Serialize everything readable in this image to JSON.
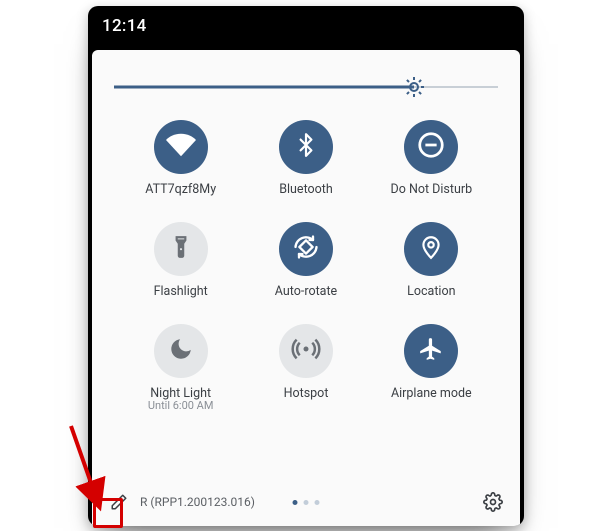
{
  "statusbar": {
    "time": "12:14"
  },
  "brightness": {
    "value": 0.78
  },
  "tiles": [
    {
      "id": "wifi",
      "label": "ATT7qzf8My",
      "sublabel": "",
      "active": true,
      "icon": "wifi"
    },
    {
      "id": "bluetooth",
      "label": "Bluetooth",
      "sublabel": "",
      "active": true,
      "icon": "bluetooth"
    },
    {
      "id": "dnd",
      "label": "Do Not Disturb",
      "sublabel": "",
      "active": true,
      "icon": "dnd"
    },
    {
      "id": "flashlight",
      "label": "Flashlight",
      "sublabel": "",
      "active": false,
      "icon": "flashlight"
    },
    {
      "id": "autorotate",
      "label": "Auto-rotate",
      "sublabel": "",
      "active": true,
      "icon": "auto-rotate"
    },
    {
      "id": "location",
      "label": "Location",
      "sublabel": "",
      "active": true,
      "icon": "location"
    },
    {
      "id": "nightlight",
      "label": "Night Light",
      "sublabel": "Until 6:00 AM",
      "active": false,
      "icon": "night-light"
    },
    {
      "id": "hotspot",
      "label": "Hotspot",
      "sublabel": "",
      "active": false,
      "icon": "hotspot"
    },
    {
      "id": "airplane",
      "label": "Airplane mode",
      "sublabel": "",
      "active": true,
      "icon": "airplane"
    }
  ],
  "footer": {
    "build": "R (RPP1.200123.016)",
    "pages": 3,
    "currentPage": 0
  },
  "colors": {
    "accent": "#3c5f87",
    "inactive": "#e4e6e8",
    "callout": "#d40000"
  }
}
